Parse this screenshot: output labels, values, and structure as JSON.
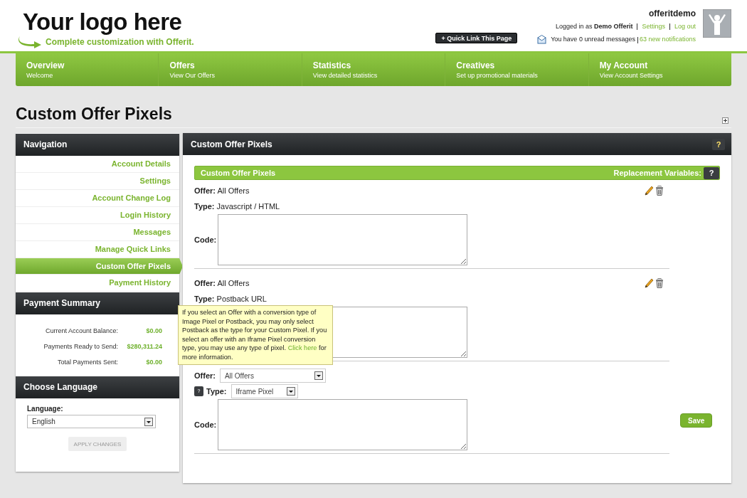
{
  "header": {
    "logo_title": "Your logo here",
    "logo_tagline": "Complete customization with Offerit.",
    "quick_link": "+ Quick Link This Page",
    "username": "offeritdemo",
    "logged_in_prefix": "Logged in as",
    "logged_in_user": "Demo Offerit",
    "settings_link": "Settings",
    "logout_link": "Log out",
    "messages_text": "You have 0 unread messages",
    "notifications_link": "63 new notifications"
  },
  "nav_tabs": [
    {
      "label": "Overview",
      "sublabel": "Welcome"
    },
    {
      "label": "Offers",
      "sublabel": "View Our Offers"
    },
    {
      "label": "Statistics",
      "sublabel": "View detailed statistics"
    },
    {
      "label": "Creatives",
      "sublabel": "Set up promotional materials"
    },
    {
      "label": "My Account",
      "sublabel": "View Account Settings"
    }
  ],
  "page_title": "Custom Offer Pixels",
  "sidebar": {
    "navigation": {
      "title": "Navigation",
      "items": [
        {
          "label": "Account Details",
          "selected": false
        },
        {
          "label": "Settings",
          "selected": false
        },
        {
          "label": "Account Change Log",
          "selected": false
        },
        {
          "label": "Login History",
          "selected": false
        },
        {
          "label": "Messages",
          "selected": false
        },
        {
          "label": "Manage Quick Links",
          "selected": false
        },
        {
          "label": "Custom Offer Pixels",
          "selected": true
        },
        {
          "label": "Payment History",
          "selected": false
        }
      ]
    },
    "payment_summary": {
      "title": "Payment Summary",
      "rows": [
        {
          "label": "Current Account Balance:",
          "value": "$0.00"
        },
        {
          "label": "Payments Ready to Send:",
          "value": "$280,311.24"
        },
        {
          "label": "Total Payments Sent:",
          "value": "$0.00"
        }
      ]
    },
    "language": {
      "title": "Choose Language",
      "label": "Language:",
      "value": "English",
      "button": "APPLY CHANGES",
      "button_disabled": true
    }
  },
  "main": {
    "title": "Custom Offer Pixels",
    "help": "?",
    "section_title": "Custom Offer Pixels",
    "replacement_label": "Replacement Variables:",
    "replacement_help": "?",
    "pixels": [
      {
        "kind": "saved",
        "offer_label": "Offer:",
        "offer": "All Offers",
        "type_label": "Type:",
        "type": "Javascript / HTML",
        "code_label": "Code:"
      },
      {
        "kind": "saved",
        "offer_label": "Offer:",
        "offer": "All Offers",
        "type_label": "Type:",
        "type": "Postback URL"
      },
      {
        "kind": "new",
        "offer_label": "Offer:",
        "offer": "All Offers",
        "type_help": "?",
        "type_label": "Type:",
        "type": "Iframe Pixel",
        "code_label": "Code:",
        "save": "Save"
      }
    ],
    "tooltip": {
      "text": "If you select an Offer with a conversion type of Image Pixel or Postback, you may only select Postback as the type for your Custom Pixel. If you select an offer with an Iframe Pixel conversion type, you may use any type of pixel. ",
      "link": "Click here",
      "after": " for more information."
    }
  }
}
